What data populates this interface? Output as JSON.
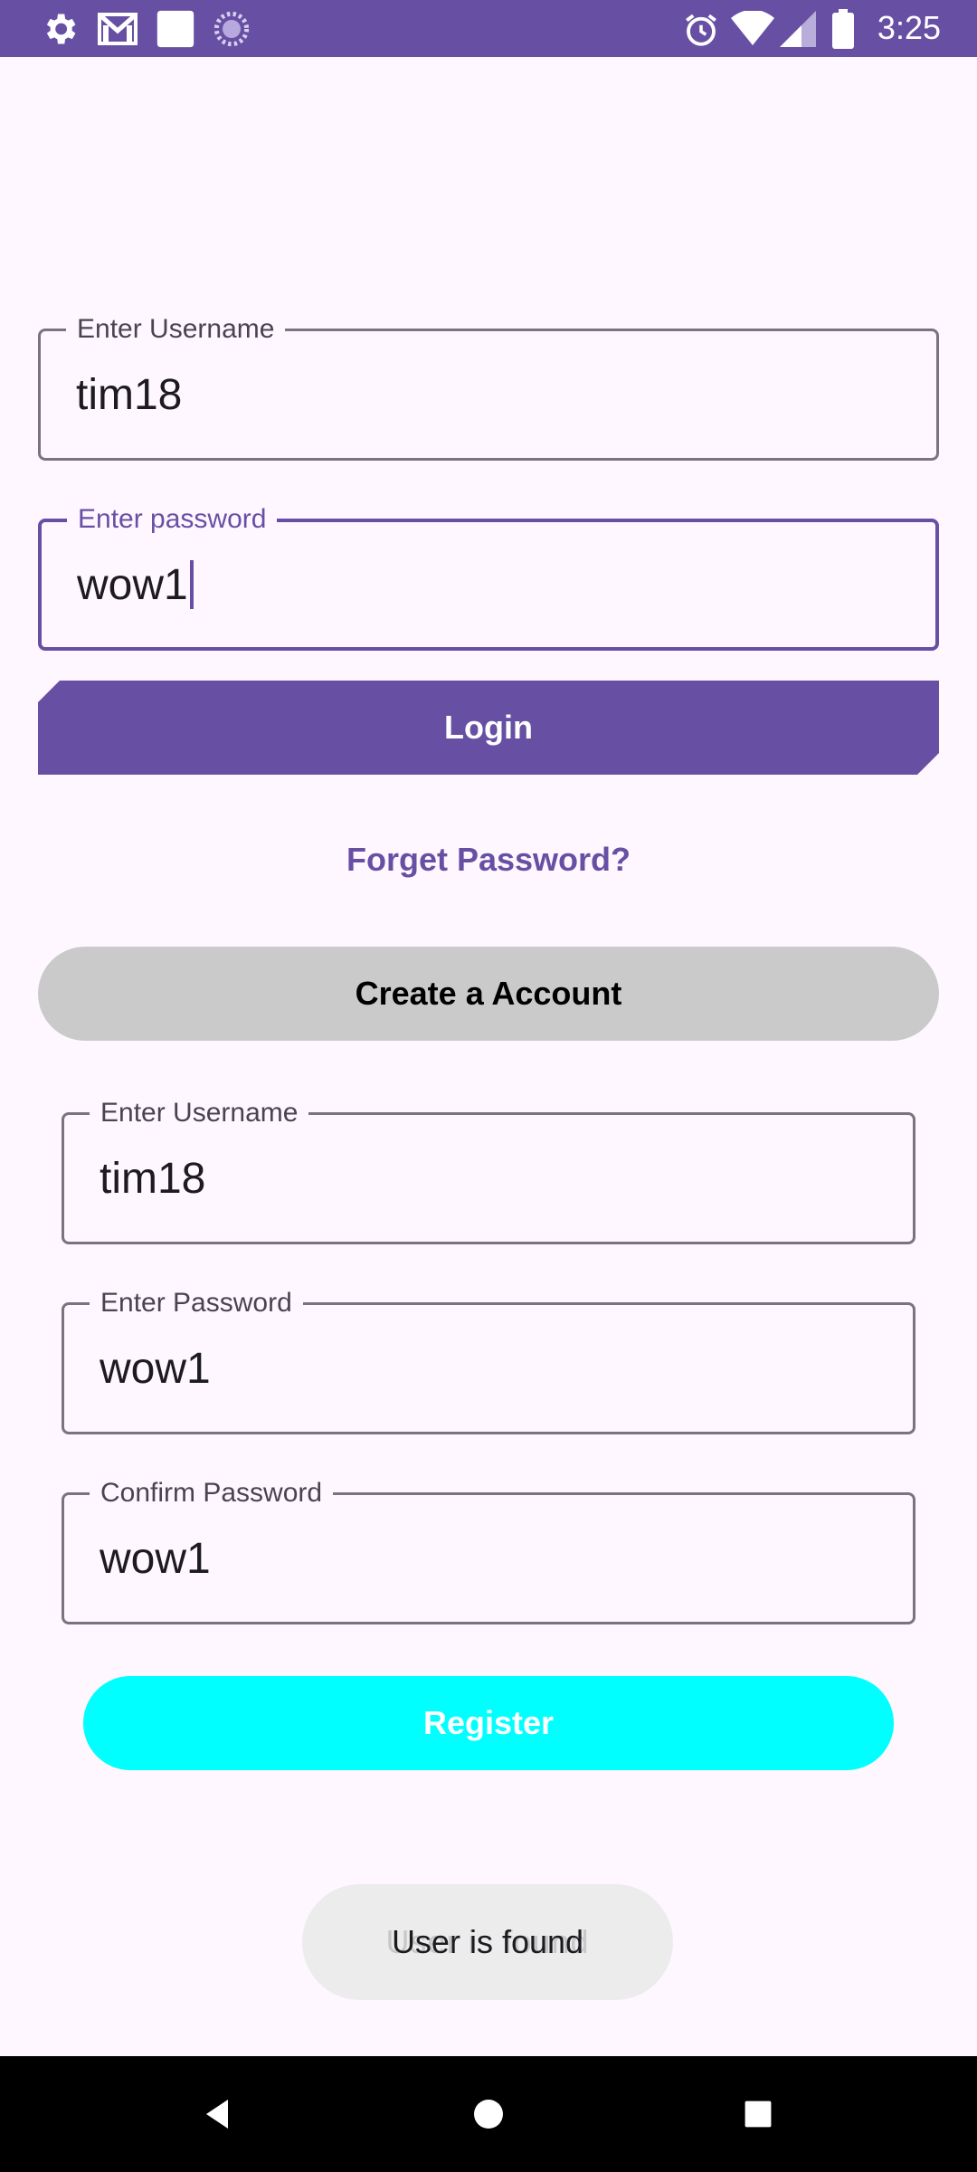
{
  "status_bar": {
    "time": "3:25",
    "icons": [
      "settings-icon",
      "gmail-icon",
      "app-square-icon",
      "sync-icon",
      "alarm-icon",
      "wifi-icon",
      "signal-icon",
      "battery-icon"
    ]
  },
  "login": {
    "username_label": "Enter Username",
    "username_value": "tim18",
    "password_label": "Enter password",
    "password_value": "wow1",
    "login_button": "Login",
    "forget_link": "Forget Password?"
  },
  "create_account_button": "Create a Account",
  "register_form": {
    "username_label": "Enter Username",
    "username_value": "tim18",
    "password_label": "Enter Password",
    "password_value": "wow1",
    "confirm_label": "Confirm Password",
    "confirm_value": "wow1",
    "register_button": "Register"
  },
  "toast": {
    "text": "User is found",
    "ghost_text": "User is found"
  },
  "nav_bar": {
    "icons": [
      "back-icon",
      "home-icon",
      "recents-icon"
    ]
  },
  "colors": {
    "primary": "#6750A4",
    "background": "#FEF7FF",
    "register": "#00FFFF",
    "create_account": "#CACACA"
  }
}
